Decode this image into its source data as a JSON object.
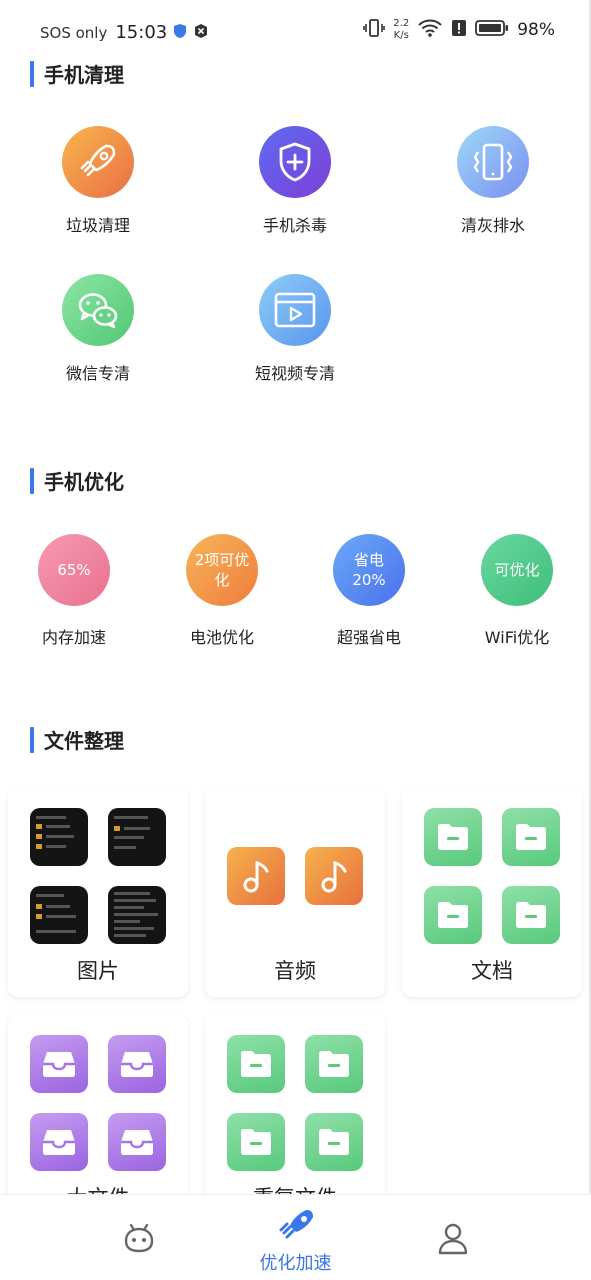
{
  "status_bar": {
    "carrier": "SOS only",
    "time": "15:03",
    "net_speed_value": "2.2",
    "net_speed_unit": "K/s",
    "battery": "98%"
  },
  "sections": {
    "clean": {
      "title": "手机清理",
      "items": [
        {
          "label": "垃圾清理",
          "icon": "rocket-icon"
        },
        {
          "label": "手机杀毒",
          "icon": "shield-plus-icon"
        },
        {
          "label": "清灰排水",
          "icon": "phone-vibrate-icon"
        },
        {
          "label": "微信专清",
          "icon": "wechat-icon"
        },
        {
          "label": "短视频专清",
          "icon": "video-play-icon"
        }
      ]
    },
    "optimize": {
      "title": "手机优化",
      "items": [
        {
          "badge": "65%",
          "label": "内存加速"
        },
        {
          "badge": "2项可优化",
          "label": "电池优化"
        },
        {
          "badge": "省电20%",
          "label": "超强省电"
        },
        {
          "badge": "可优化",
          "label": "WiFi优化"
        }
      ]
    },
    "files": {
      "title": "文件整理",
      "cards": [
        {
          "name": "图片",
          "type": "screenshots"
        },
        {
          "name": "音频",
          "type": "music"
        },
        {
          "name": "文档",
          "type": "folder"
        },
        {
          "name": "大文件",
          "type": "box"
        },
        {
          "name": "重复文件",
          "type": "folder"
        }
      ]
    }
  },
  "bottom_nav": {
    "items": [
      {
        "icon": "robot-icon",
        "label": ""
      },
      {
        "icon": "rocket-icon",
        "label": "优化加速",
        "active": true
      },
      {
        "icon": "person-icon",
        "label": ""
      }
    ]
  },
  "colors": {
    "accent": "#3b78e7",
    "clean_gradients": [
      "#f0a04a",
      "#6a5de0",
      "#8fc8f5",
      "#6fd88f",
      "#78b8f5"
    ],
    "optimize_gradients": [
      "#f08aa0",
      "#f29a48",
      "#5a8cf2",
      "#5acb8e"
    ]
  }
}
